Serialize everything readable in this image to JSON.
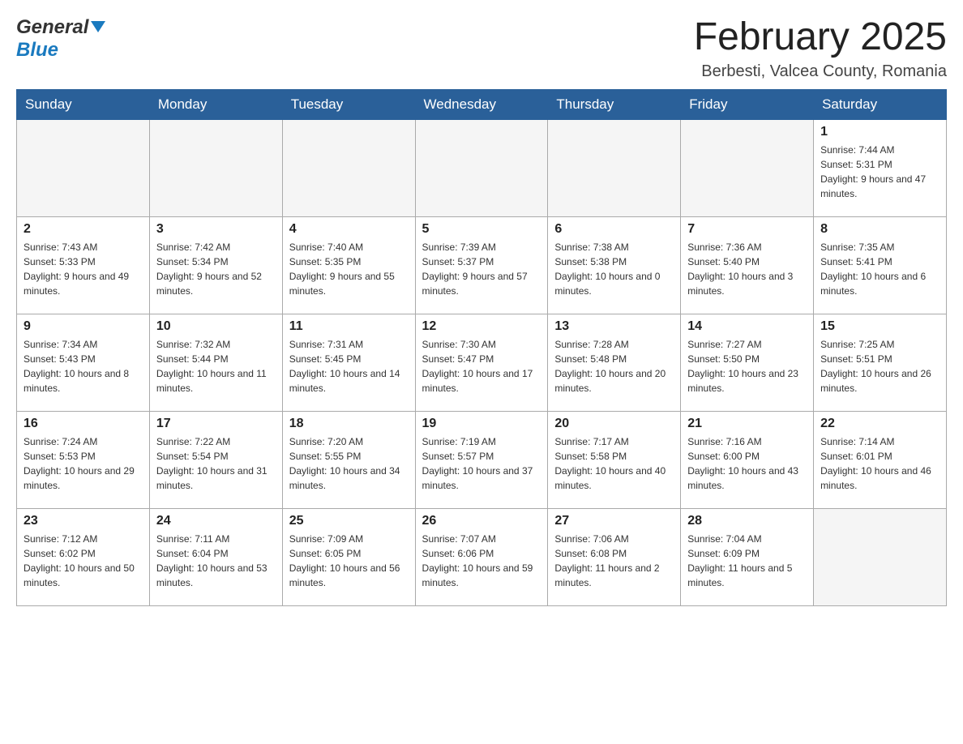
{
  "header": {
    "month_year": "February 2025",
    "location": "Berbesti, Valcea County, Romania",
    "logo_general": "General",
    "logo_blue": "Blue"
  },
  "days_of_week": [
    "Sunday",
    "Monday",
    "Tuesday",
    "Wednesday",
    "Thursday",
    "Friday",
    "Saturday"
  ],
  "weeks": [
    [
      {
        "day": "",
        "info": ""
      },
      {
        "day": "",
        "info": ""
      },
      {
        "day": "",
        "info": ""
      },
      {
        "day": "",
        "info": ""
      },
      {
        "day": "",
        "info": ""
      },
      {
        "day": "",
        "info": ""
      },
      {
        "day": "1",
        "info": "Sunrise: 7:44 AM\nSunset: 5:31 PM\nDaylight: 9 hours and 47 minutes."
      }
    ],
    [
      {
        "day": "2",
        "info": "Sunrise: 7:43 AM\nSunset: 5:33 PM\nDaylight: 9 hours and 49 minutes."
      },
      {
        "day": "3",
        "info": "Sunrise: 7:42 AM\nSunset: 5:34 PM\nDaylight: 9 hours and 52 minutes."
      },
      {
        "day": "4",
        "info": "Sunrise: 7:40 AM\nSunset: 5:35 PM\nDaylight: 9 hours and 55 minutes."
      },
      {
        "day": "5",
        "info": "Sunrise: 7:39 AM\nSunset: 5:37 PM\nDaylight: 9 hours and 57 minutes."
      },
      {
        "day": "6",
        "info": "Sunrise: 7:38 AM\nSunset: 5:38 PM\nDaylight: 10 hours and 0 minutes."
      },
      {
        "day": "7",
        "info": "Sunrise: 7:36 AM\nSunset: 5:40 PM\nDaylight: 10 hours and 3 minutes."
      },
      {
        "day": "8",
        "info": "Sunrise: 7:35 AM\nSunset: 5:41 PM\nDaylight: 10 hours and 6 minutes."
      }
    ],
    [
      {
        "day": "9",
        "info": "Sunrise: 7:34 AM\nSunset: 5:43 PM\nDaylight: 10 hours and 8 minutes."
      },
      {
        "day": "10",
        "info": "Sunrise: 7:32 AM\nSunset: 5:44 PM\nDaylight: 10 hours and 11 minutes."
      },
      {
        "day": "11",
        "info": "Sunrise: 7:31 AM\nSunset: 5:45 PM\nDaylight: 10 hours and 14 minutes."
      },
      {
        "day": "12",
        "info": "Sunrise: 7:30 AM\nSunset: 5:47 PM\nDaylight: 10 hours and 17 minutes."
      },
      {
        "day": "13",
        "info": "Sunrise: 7:28 AM\nSunset: 5:48 PM\nDaylight: 10 hours and 20 minutes."
      },
      {
        "day": "14",
        "info": "Sunrise: 7:27 AM\nSunset: 5:50 PM\nDaylight: 10 hours and 23 minutes."
      },
      {
        "day": "15",
        "info": "Sunrise: 7:25 AM\nSunset: 5:51 PM\nDaylight: 10 hours and 26 minutes."
      }
    ],
    [
      {
        "day": "16",
        "info": "Sunrise: 7:24 AM\nSunset: 5:53 PM\nDaylight: 10 hours and 29 minutes."
      },
      {
        "day": "17",
        "info": "Sunrise: 7:22 AM\nSunset: 5:54 PM\nDaylight: 10 hours and 31 minutes."
      },
      {
        "day": "18",
        "info": "Sunrise: 7:20 AM\nSunset: 5:55 PM\nDaylight: 10 hours and 34 minutes."
      },
      {
        "day": "19",
        "info": "Sunrise: 7:19 AM\nSunset: 5:57 PM\nDaylight: 10 hours and 37 minutes."
      },
      {
        "day": "20",
        "info": "Sunrise: 7:17 AM\nSunset: 5:58 PM\nDaylight: 10 hours and 40 minutes."
      },
      {
        "day": "21",
        "info": "Sunrise: 7:16 AM\nSunset: 6:00 PM\nDaylight: 10 hours and 43 minutes."
      },
      {
        "day": "22",
        "info": "Sunrise: 7:14 AM\nSunset: 6:01 PM\nDaylight: 10 hours and 46 minutes."
      }
    ],
    [
      {
        "day": "23",
        "info": "Sunrise: 7:12 AM\nSunset: 6:02 PM\nDaylight: 10 hours and 50 minutes."
      },
      {
        "day": "24",
        "info": "Sunrise: 7:11 AM\nSunset: 6:04 PM\nDaylight: 10 hours and 53 minutes."
      },
      {
        "day": "25",
        "info": "Sunrise: 7:09 AM\nSunset: 6:05 PM\nDaylight: 10 hours and 56 minutes."
      },
      {
        "day": "26",
        "info": "Sunrise: 7:07 AM\nSunset: 6:06 PM\nDaylight: 10 hours and 59 minutes."
      },
      {
        "day": "27",
        "info": "Sunrise: 7:06 AM\nSunset: 6:08 PM\nDaylight: 11 hours and 2 minutes."
      },
      {
        "day": "28",
        "info": "Sunrise: 7:04 AM\nSunset: 6:09 PM\nDaylight: 11 hours and 5 minutes."
      },
      {
        "day": "",
        "info": ""
      }
    ]
  ]
}
